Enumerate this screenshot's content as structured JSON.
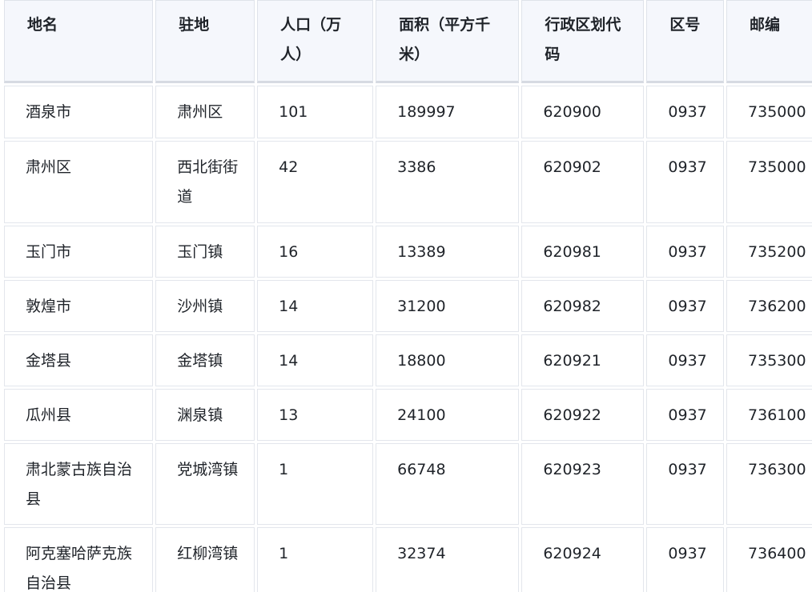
{
  "table": {
    "headers": [
      "地名",
      "驻地",
      "人口（万人）",
      "面积（平方千米）",
      "行政区划代码",
      "区号",
      "邮编"
    ],
    "rows": [
      [
        "酒泉市",
        "肃州区",
        "101",
        "189997",
        "620900",
        "0937",
        "735000"
      ],
      [
        "肃州区",
        "西北街街道",
        "42",
        "3386",
        "620902",
        "0937",
        "735000"
      ],
      [
        "玉门市",
        "玉门镇",
        "16",
        "13389",
        "620981",
        "0937",
        "735200"
      ],
      [
        "敦煌市",
        "沙州镇",
        "14",
        "31200",
        "620982",
        "0937",
        "736200"
      ],
      [
        "金塔县",
        "金塔镇",
        "14",
        "18800",
        "620921",
        "0937",
        "735300"
      ],
      [
        "瓜州县",
        "渊泉镇",
        "13",
        "24100",
        "620922",
        "0937",
        "736100"
      ],
      [
        "肃北蒙古族自治县",
        "党城湾镇",
        "1",
        "66748",
        "620923",
        "0937",
        "736300"
      ],
      [
        "阿克塞哈萨克族自治县",
        "红柳湾镇",
        "1",
        "32374",
        "620924",
        "0937",
        "736400"
      ]
    ]
  },
  "colors": {
    "header_background": "#f5f7fc",
    "border": "#dfe3ea",
    "text": "#1f2329"
  }
}
